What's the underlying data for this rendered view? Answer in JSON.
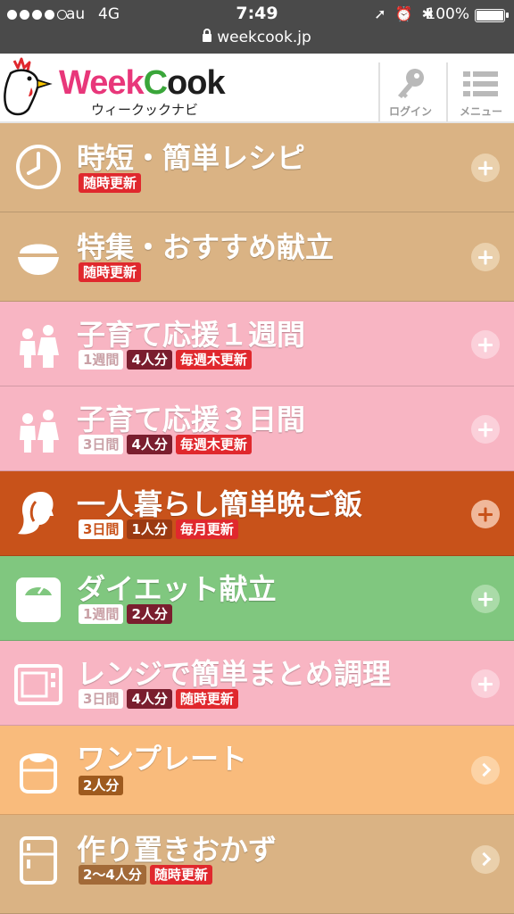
{
  "status_bar": {
    "carrier": "au",
    "network": "4G",
    "time": "7:49",
    "battery": "100%",
    "url": "weekcook.jp"
  },
  "header": {
    "logo_title": "WeekCook",
    "logo_sub": "ウィークックナビ",
    "login_label": "ログイン",
    "menu_label": "メニュー"
  },
  "menu": [
    {
      "title": "時短・簡単レシピ",
      "tags": [
        "随時更新"
      ],
      "bg": "#dab384",
      "action": "plus"
    },
    {
      "title": "特集・おすすめ献立",
      "tags": [
        "随時更新"
      ],
      "bg": "#dab384",
      "action": "plus"
    },
    {
      "title": "子育て応援１週間",
      "tags": [
        "1週間",
        "4人分",
        "毎週木更新"
      ],
      "bg": "#f8b5c3",
      "action": "plus"
    },
    {
      "title": "子育て応援３日間",
      "tags": [
        "3日間",
        "4人分",
        "毎週木更新"
      ],
      "bg": "#f8b5c3",
      "action": "plus"
    },
    {
      "title": "一人暮らし簡単晩ご飯",
      "tags": [
        "3日間",
        "1人分",
        "毎月更新"
      ],
      "bg": "#c8521a",
      "action": "plus"
    },
    {
      "title": "ダイエット献立",
      "tags": [
        "1週間",
        "2人分"
      ],
      "bg": "#80c77f",
      "action": "plus"
    },
    {
      "title": "レンジで簡単まとめ調理",
      "tags": [
        "3日間",
        "4人分",
        "随時更新"
      ],
      "bg": "#f8b5c3",
      "action": "plus"
    },
    {
      "title": "ワンプレート",
      "tags": [
        "2人分"
      ],
      "bg": "#f9bb7c",
      "action": "chevron"
    },
    {
      "title": "作り置きおかず",
      "tags": [
        "2～4人分",
        "随時更新"
      ],
      "bg": "#dab384",
      "action": "chevron"
    }
  ],
  "icons": [
    "clock-icon",
    "rice-bowl-icon",
    "children-icon",
    "children-icon",
    "woman-profile-icon",
    "scale-icon",
    "microwave-icon",
    "rice-cooker-icon",
    "refrigerator-icon"
  ]
}
